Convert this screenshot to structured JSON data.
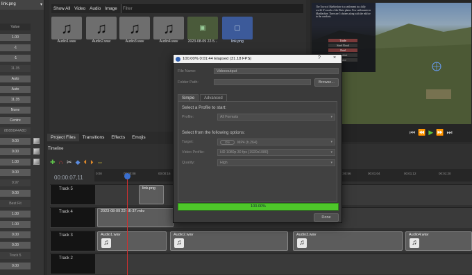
{
  "left_panel": {
    "file_title": "link.png",
    "rows": [
      {
        "value": "Value",
        "style": "hdr"
      },
      {
        "value": "1.00",
        "style": "val"
      },
      {
        "value": "-1",
        "style": "val"
      },
      {
        "value": "-1",
        "style": "val"
      },
      {
        "value": "11.35",
        "style": "dark"
      },
      {
        "value": "Auto",
        "style": "val"
      },
      {
        "value": "Auto",
        "style": "val"
      },
      {
        "value": "11.35",
        "style": "val"
      },
      {
        "value": "None",
        "style": "val"
      },
      {
        "value": "Centre",
        "style": "val"
      },
      {
        "value": "8B8B8A4A8D",
        "style": "dark"
      },
      {
        "value": "0.00",
        "style": "val",
        "swatch": true
      },
      {
        "value": "0.00",
        "style": "val",
        "swatch": true
      },
      {
        "value": "1.00",
        "style": "val",
        "swatch": true
      },
      {
        "value": "0.00",
        "style": "val"
      },
      {
        "value": "9.97",
        "style": "dark"
      },
      {
        "value": "0.00",
        "style": "val"
      },
      {
        "value": "Best Fit",
        "style": "dark"
      },
      {
        "value": "1.00",
        "style": "val"
      },
      {
        "value": "1.00",
        "style": "val"
      },
      {
        "value": "0.00",
        "style": "val"
      },
      {
        "value": "0.00",
        "style": "val"
      },
      {
        "value": "Track 5",
        "style": "dark"
      },
      {
        "value": "0.00",
        "style": "val"
      }
    ]
  },
  "bin": {
    "tabs": [
      "Show All",
      "Video",
      "Audio",
      "Image"
    ],
    "filter_placeholder": "Filter",
    "items": [
      {
        "label": "Audio1.wav",
        "icon": "music-note-icon"
      },
      {
        "label": "Audio2.wav",
        "icon": "music-note-icon"
      },
      {
        "label": "Audio3.wav",
        "icon": "music-note-icon"
      },
      {
        "label": "Audio4.wav",
        "icon": "music-note-icon"
      },
      {
        "label": "2023-08-09 22-5...",
        "icon": "video-thumbnail-icon"
      },
      {
        "label": "link.png",
        "icon": "image-thumbnail-icon"
      }
    ]
  },
  "preview": {
    "overlay_text": "The Town of Marbleshire is a settlement in a hilly world. It's north of the Hertz plains. Few settlements in Marbleshire. There are 5 shrines along with the edifice in the outskirts.",
    "labels": [
      "Trade",
      "Steel Road",
      "Raid",
      "Combat",
      "Leave"
    ]
  },
  "panel_tabs": [
    "Project Files",
    "Transitions",
    "Effects",
    "Emojis"
  ],
  "timeline": {
    "label": "Timeline",
    "timecode": "00:00:07,11",
    "ticks": [
      "0:08",
      "00:00:08",
      "00:00:16",
      "00:00:56",
      "00:01:04",
      "00:01:12",
      "00:01:20"
    ],
    "tracks": [
      {
        "name": "Track 5"
      },
      {
        "name": "Track 4"
      },
      {
        "name": "Track 3"
      },
      {
        "name": "Track 2"
      }
    ],
    "clips": {
      "link": "link.png",
      "video": "2023-08-09 22-56-37.mkv",
      "audio": [
        "Audio1.wav",
        "Audio2.wav",
        "Audio3.wav",
        "Audio4.wav"
      ]
    }
  },
  "dialog": {
    "title": "100.00% 0:01:44 Elapsed (31.18 FPS)",
    "help": "?",
    "close": "×",
    "file_name_label": "File Name:",
    "file_name_value": "Videooutput",
    "folder_path_label": "Folder Path:",
    "browse": "Browse...",
    "tabs": [
      "Simple",
      "Advanced"
    ],
    "profile_section": "Select a Profile to start:",
    "profile_label": "Profile:",
    "profile_value": "All Formats",
    "options_section": "Select from the following options:",
    "target_label": "Target:",
    "target_toggle": "Ofv",
    "target_value": "MP4 (h.264)",
    "video_profile_label": "Video Profile:",
    "video_profile_value": "HD 1080p 30 fps (1920x1080)",
    "quality_label": "Quality:",
    "quality_value": "High",
    "progress": "100.00%",
    "done": "Done"
  }
}
